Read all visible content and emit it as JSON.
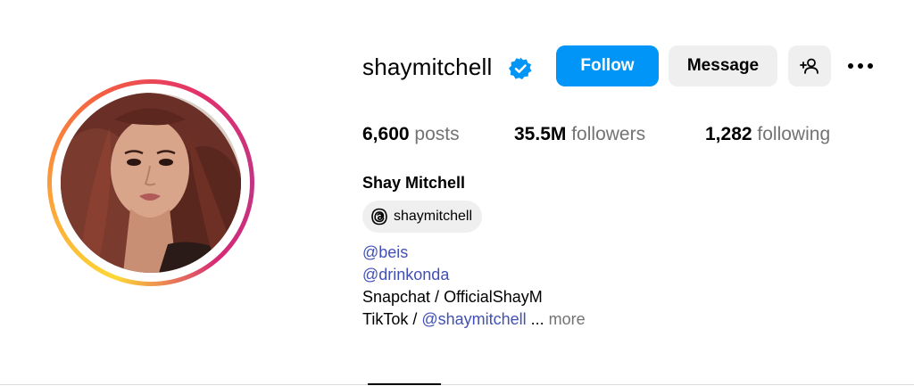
{
  "profile": {
    "username": "shaymitchell",
    "verified": true,
    "full_name": "Shay Mitchell",
    "avatar_icon": "profile-photo",
    "threads_handle": "shaymitchell"
  },
  "actions": {
    "follow_label": "Follow",
    "message_label": "Message",
    "add_user_icon": "person-add-icon",
    "more_icon": "ellipsis-icon"
  },
  "stats": {
    "posts_count": "6,600",
    "posts_label": "posts",
    "followers_count": "35.5M",
    "followers_label": "followers",
    "following_count": "1,282",
    "following_label": "following"
  },
  "bio": {
    "line1": "@beis",
    "line2": "@drinkonda",
    "line3": "Snapchat / OfficialShayM",
    "line4_prefix": "TikTok / ",
    "line4_link": "@shaymitchell",
    "line4_ellipsis": " ... ",
    "more_label": "more"
  },
  "colors": {
    "follow_button": "#0095f6",
    "link": "#4150b8",
    "secondary_text": "#737373",
    "verified_badge": "#0095f6"
  }
}
